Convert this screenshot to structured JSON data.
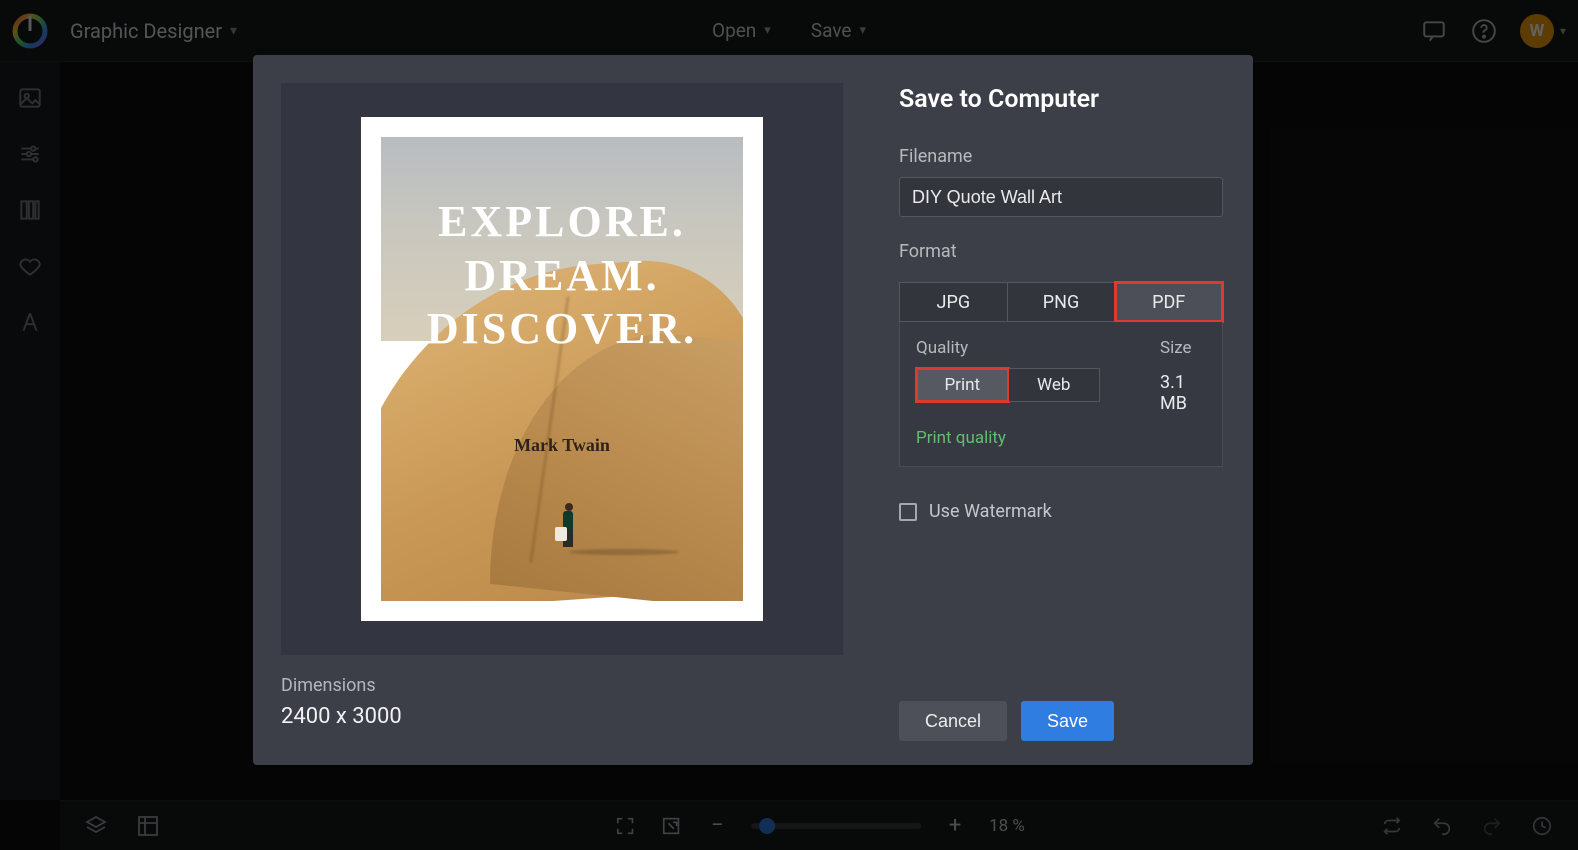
{
  "header": {
    "mode_label": "Graphic Designer",
    "menu_open": "Open",
    "menu_save": "Save",
    "avatar_letter": "W"
  },
  "bottom": {
    "zoom_pct": "18 %"
  },
  "modal": {
    "title": "Save to Computer",
    "filename_label": "Filename",
    "filename_value": "DIY Quote Wall Art",
    "format_label": "Format",
    "formats": {
      "jpg": "JPG",
      "png": "PNG",
      "pdf": "PDF"
    },
    "quality_label": "Quality",
    "quality_options": {
      "print": "Print",
      "web": "Web"
    },
    "quality_hint": "Print quality",
    "size_label": "Size",
    "size_value": "3.1 MB",
    "watermark_label": "Use Watermark",
    "cancel": "Cancel",
    "save": "Save",
    "dimensions_label": "Dimensions",
    "dimensions_value": "2400 x 3000"
  },
  "poster": {
    "line1": "EXPLORE.",
    "line2": "DREAM.",
    "line3": "DISCOVER.",
    "author": "Mark Twain"
  }
}
